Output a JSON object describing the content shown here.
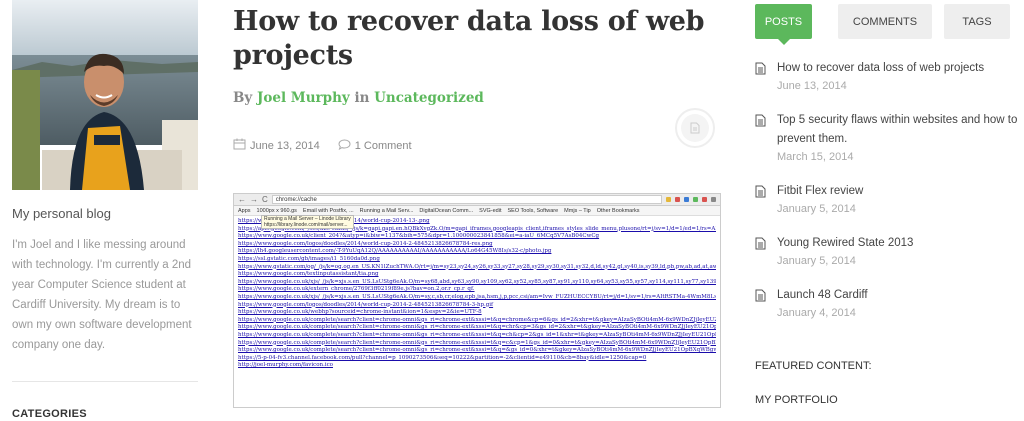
{
  "sidebar": {
    "blog_title": "My personal blog",
    "description": "I'm Joel and I like messing around with technology. I'm currently a 2nd year Computer Science student at Cardiff University. My dream is to own my own software development company one day.",
    "categories_heading": "CATEGORIES"
  },
  "post": {
    "title": "How to recover data loss of web projects",
    "by": "By",
    "author": "Joel Murphy",
    "in": "in",
    "category": "Uncategorized",
    "date": "June 13, 2014",
    "comments": "1 Comment",
    "screenshot": {
      "url": "chrome://cache",
      "tooltip_line1": "Running a Mail Server – Linode Library",
      "tooltip_line2": "https://library.linode.com/mail/server...",
      "bookmarks": [
        "Apps",
        "1000px x 960.gs",
        "Email with Postfix, ...",
        "Running a Mail Serv...",
        "DigitalOcean Comm...",
        "SVG-edit",
        "SEO Tools, Software",
        "Mmjs – Tip",
        "Other Bookmarks"
      ],
      "links": [
        "https://www.google.com/logos/doodles/2014/world-cup-2014-13-.png",
        "https://apis.google.com/_/scs/abc-static/_/js/k=gapi.gapi.en.hQBkXvgZk.O/m=gapi_iframes,googleapis_client,iframes_styles_slide_menu,plusone/rt=j/sv=1/d=1/ed=1/rs=AItRSTPQVFSRVEutbq",
        "https://www.google.co.uk/client_204?&atyp=i&biw=1137&bih=575&dpr=1.100000023841858&ei=a-iaU_6MCq5V7AsB04CwCg",
        "https://www.google.com/logos/doodles/2014/world-cup-2014-2-4845213826678784-res.png",
        "https://lh4.googleusercontent.com/-T-9YuUqA12Q/AAAAAAAAAAI/AAAAAAAAAAA/Lo64G45W8Is/s32-c/photo.jpg",
        "https://ssl.gstatic.com/gb/images/i1_5160da0d.png",
        "https://www.gstatic.com/og/_/js/k=og.og.en_US.KN1lZuchTWA.O/rt=j/m=sy23,sy24,sy26,sy33,sy27,sy28,sy29,sy30,sy31,sy32,d,ld,sy42,gl,sy40,is,sy39,ld,pb,pw,ab,ad,at,awd,sy36,sy37,p,vd,lod",
        "https://www.google.com/textinputassistant/tia.png",
        "https://www.google.co.uk/xjs/_/js/k=xjs.s.en_US.LsUStg6eAk.O/m=sy68,abd,sy63,sy90,sy109,sy62,sy52,sy85,sy87,sy91,sy110,sy64,sy53,sy55,sy57,sy114,sy111,sy77,sy139,sy65,sy124,sy54,s",
        "https://www.google.co.uk/extern_chrome/2769f3ff0219f89e.js?bav=on.2,or.r_cp.r_qf.",
        "https://www.google.co.uk/xjs/_/js/k=xjs.s.en_US.LsUStg6eAk.O/m=sy,c,sb,cr,elog,epb,jsa,hsm,j,p,pcc,csi/am=Ivw_FUZHUECCYBU/rt=j/d=1/sv=1/rs=AItRSTMa-4WmM8LswLgSF",
        "https://www.google.com/logos/doodles/2014/world-cup-2014-2-4845213826678784-3-hp.gif",
        "https://www.google.co.uk/webhp?sourceid=chrome-instant&ion=1&espv=2&ie=UTF-8",
        "https://www.google.co.uk/complete/search?client=chrome-omni&gs_ri=chrome-ext&xssi=t&q=chrome&cp=6&gs_id=2&xhr=t&gkey=AIzaSyBOti4mM-6x9WDnZJjIeyEU21OpBXqWBgw",
        "https://www.google.co.uk/complete/search?client=chrome-omni&gs_ri=chrome-ext&xssi=t&q=chr&cp=3&gs_id=2&xhr=t&gkey=AIzaSyBOti4mM-6x9WDnZJjIeyEU21OpBXqWBgw",
        "https://www.google.co.uk/complete/search?client=chrome-omni&gs_ri=chrome-ext&xssi=t&q=ch&cp=2&gs_id=1&xhr=t&gkey=AIzaSyBOti4mM-6x9WDnZJjIeyEU21OpBXqWBgw",
        "https://www.google.co.uk/complete/search?client=chrome-omni&gs_ri=chrome-ext&xssi=t&q=c&cp=1&gs_id=0&xhr=t&gkey=AIzaSyBOti4mM-6x9WDnZJjIeyEU21OpBXqWBgw",
        "https://www.google.co.uk/complete/search?client=chrome-omni&gs_ri=chrome-ext&xssi=t&q=&gs_id=0&xhr=t&gkey=AIzaSyBOti4mM-6x9WDnZJjIeyEU21OpBXqWBgw",
        "https://5-p-04-fv3.channel.facebook.com/pull?channel=p_1090273506&seq=10222&partition=-2&clientid=e49110&cb=8bay&idle=1250&cap=0",
        "http://joel-murphy.com/favicon.ico"
      ]
    }
  },
  "right": {
    "tabs": [
      "POSTS",
      "COMMENTS",
      "TAGS"
    ],
    "posts": [
      {
        "title": "How to recover data loss of web projects",
        "date": "June 13, 2014"
      },
      {
        "title": "Top 5 security flaws within websites and how to prevent them.",
        "date": "March 15, 2014"
      },
      {
        "title": "Fitbit Flex review",
        "date": "January 5, 2014"
      },
      {
        "title": "Young Rewired State 2013",
        "date": "January 5, 2014"
      },
      {
        "title": "Launch 48 Cardiff",
        "date": "January 4, 2014"
      }
    ],
    "featured_heading": "FEATURED CONTENT:",
    "portfolio": "MY PORTFOLIO"
  },
  "colors": {
    "accent": "#5cb85c",
    "link": "#1a0dab"
  }
}
